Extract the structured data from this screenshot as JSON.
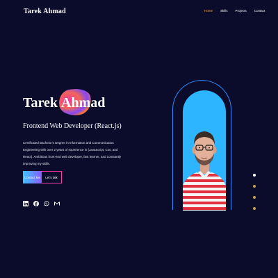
{
  "nav": {
    "brand": "Tarek Ahmad",
    "links": [
      "Home",
      "Skills",
      "Projects",
      "Contact"
    ],
    "active_index": 0
  },
  "hero": {
    "name_first": "Tarek",
    "name_last": "Ahmad",
    "subtitle": "Frontend Web Developer (React.js)",
    "description": "Certificated Bachelor's Degree in Information and Communication Engineering with over 2 years of experience in (JavaScript, Css, and React). Ambitious front-end web developer, fast learner, and constantly improving my skills.",
    "buttons": {
      "primary": "Contact Me",
      "secondary": "Let's talk"
    }
  },
  "socials": [
    "linkedin-icon",
    "facebook-icon",
    "whatsapp-icon",
    "gmail-icon"
  ],
  "colors": {
    "background": "#0b0b2b",
    "accent": "#ffb13b",
    "portrait_bg": "#2eb5ff",
    "arc": "#2b8cff",
    "button_gradient_start": "#3cc4ff",
    "button_gradient_end": "#8b5cff",
    "outline": "#ff3da6"
  }
}
